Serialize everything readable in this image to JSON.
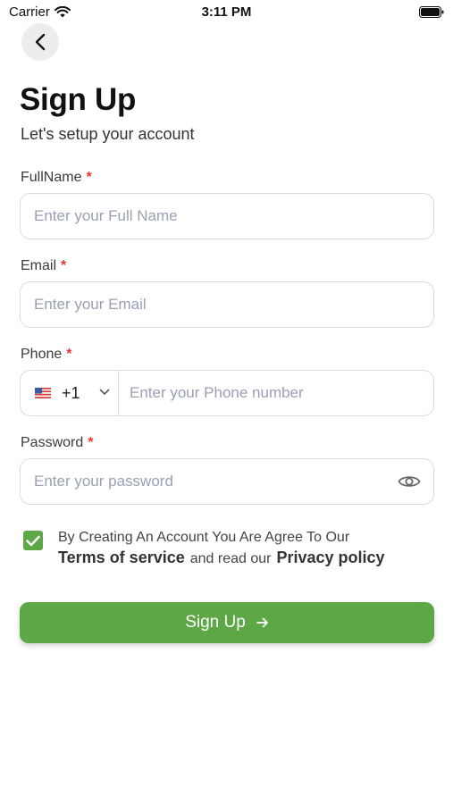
{
  "status_bar": {
    "carrier": "Carrier",
    "time": "3:11 PM"
  },
  "header": {
    "title": "Sign Up",
    "subtitle": "Let's setup your account"
  },
  "form": {
    "full_name": {
      "label": "FullName",
      "required_mark": "*",
      "placeholder": "Enter your Full Name",
      "value": ""
    },
    "email": {
      "label": "Email",
      "required_mark": "*",
      "placeholder": "Enter your Email",
      "value": ""
    },
    "phone": {
      "label": "Phone",
      "required_mark": "*",
      "country_flag": "us-flag-icon",
      "dial_code": "+1",
      "placeholder": "Enter your Phone number",
      "value": ""
    },
    "password": {
      "label": "Password",
      "required_mark": "*",
      "placeholder": "Enter your password",
      "value": ""
    }
  },
  "agreement": {
    "checked": true,
    "text_line1": "By Creating An Account You Are Agree To Our",
    "terms_link": "Terms of service",
    "middle_text": "and read our",
    "privacy_link": "Privacy policy"
  },
  "submit": {
    "label": "Sign Up",
    "icon": "arrow-right-icon"
  },
  "colors": {
    "accent": "#5ea746",
    "required": "#e53935",
    "placeholder": "#9aa0b4",
    "border": "#dcdcdc"
  }
}
